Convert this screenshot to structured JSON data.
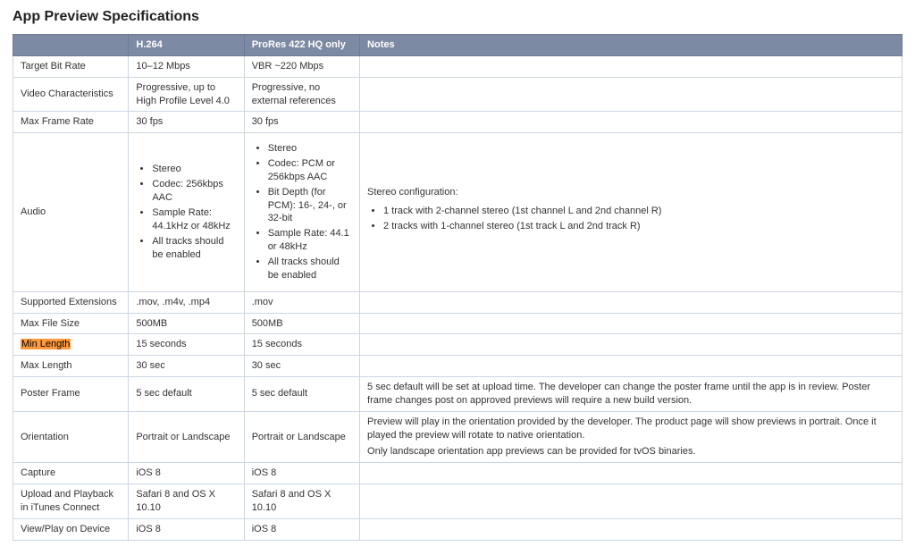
{
  "title": "App Preview Specifications",
  "columns": {
    "label": "",
    "h264": "H.264",
    "prores": "ProRes 422 HQ only",
    "notes": "Notes"
  },
  "rows": {
    "target_bit_rate": {
      "label": "Target Bit Rate",
      "h264": "10–12 Mbps",
      "prores": "VBR ~220 Mbps",
      "notes": ""
    },
    "video_characteristics": {
      "label": "Video Characteristics",
      "h264": "Progressive, up to High Profile Level 4.0",
      "prores": "Progressive, no external references",
      "notes": ""
    },
    "max_frame_rate": {
      "label": "Max Frame Rate",
      "h264": "30 fps",
      "prores": "30 fps",
      "notes": ""
    },
    "audio": {
      "label": "Audio",
      "h264_list": [
        "Stereo",
        "Codec: 256kbps AAC",
        "Sample Rate: 44.1kHz or 48kHz",
        "All tracks should be enabled"
      ],
      "prores_list": [
        "Stereo",
        "Codec: PCM or 256kbps AAC",
        "Bit Depth (for PCM): 16-, 24-, or 32-bit",
        "Sample Rate: 44.1 or 48kHz",
        "All tracks should be enabled"
      ],
      "notes_lead": "Stereo configuration:",
      "notes_list": [
        "1 track with 2-channel stereo (1st channel L and 2nd channel R)",
        "2 tracks with 1-channel stereo (1st track L and 2nd track R)"
      ]
    },
    "supported_extensions": {
      "label": "Supported Extensions",
      "h264": ".mov, .m4v, .mp4",
      "prores": ".mov",
      "notes": ""
    },
    "max_file_size": {
      "label": "Max File Size",
      "h264": "500MB",
      "prores": "500MB",
      "notes": ""
    },
    "min_length": {
      "label": "Min Length",
      "h264": "15 seconds",
      "prores": "15 seconds",
      "notes": ""
    },
    "max_length": {
      "label": "Max Length",
      "h264": "30 sec",
      "prores": "30 sec",
      "notes": ""
    },
    "poster_frame": {
      "label": "Poster Frame",
      "h264": "5 sec default",
      "prores": "5 sec default",
      "notes": "5 sec default will be set at upload time. The developer can change the poster frame until the app is in review. Poster frame changes post on approved previews will require a new build version."
    },
    "orientation": {
      "label": "Orientation",
      "h264": "Portrait or Landscape",
      "prores": "Portrait or Landscape",
      "notes_line1": "Preview will play in the orientation provided by the developer. The product page will show previews in portrait. Once it played the preview will rotate to native orientation.",
      "notes_line2": "Only landscape orientation app previews can be provided for tvOS binaries."
    },
    "capture": {
      "label": "Capture",
      "h264": "iOS 8",
      "prores": "iOS 8",
      "notes": ""
    },
    "upload_playback": {
      "label": "Upload and Playback in iTunes Connect",
      "h264": "Safari 8 and OS X 10.10",
      "prores": "Safari 8 and OS X 10.10",
      "notes": ""
    },
    "view_play": {
      "label": "View/Play on Device",
      "h264": "iOS 8",
      "prores": "iOS 8",
      "notes": ""
    }
  }
}
